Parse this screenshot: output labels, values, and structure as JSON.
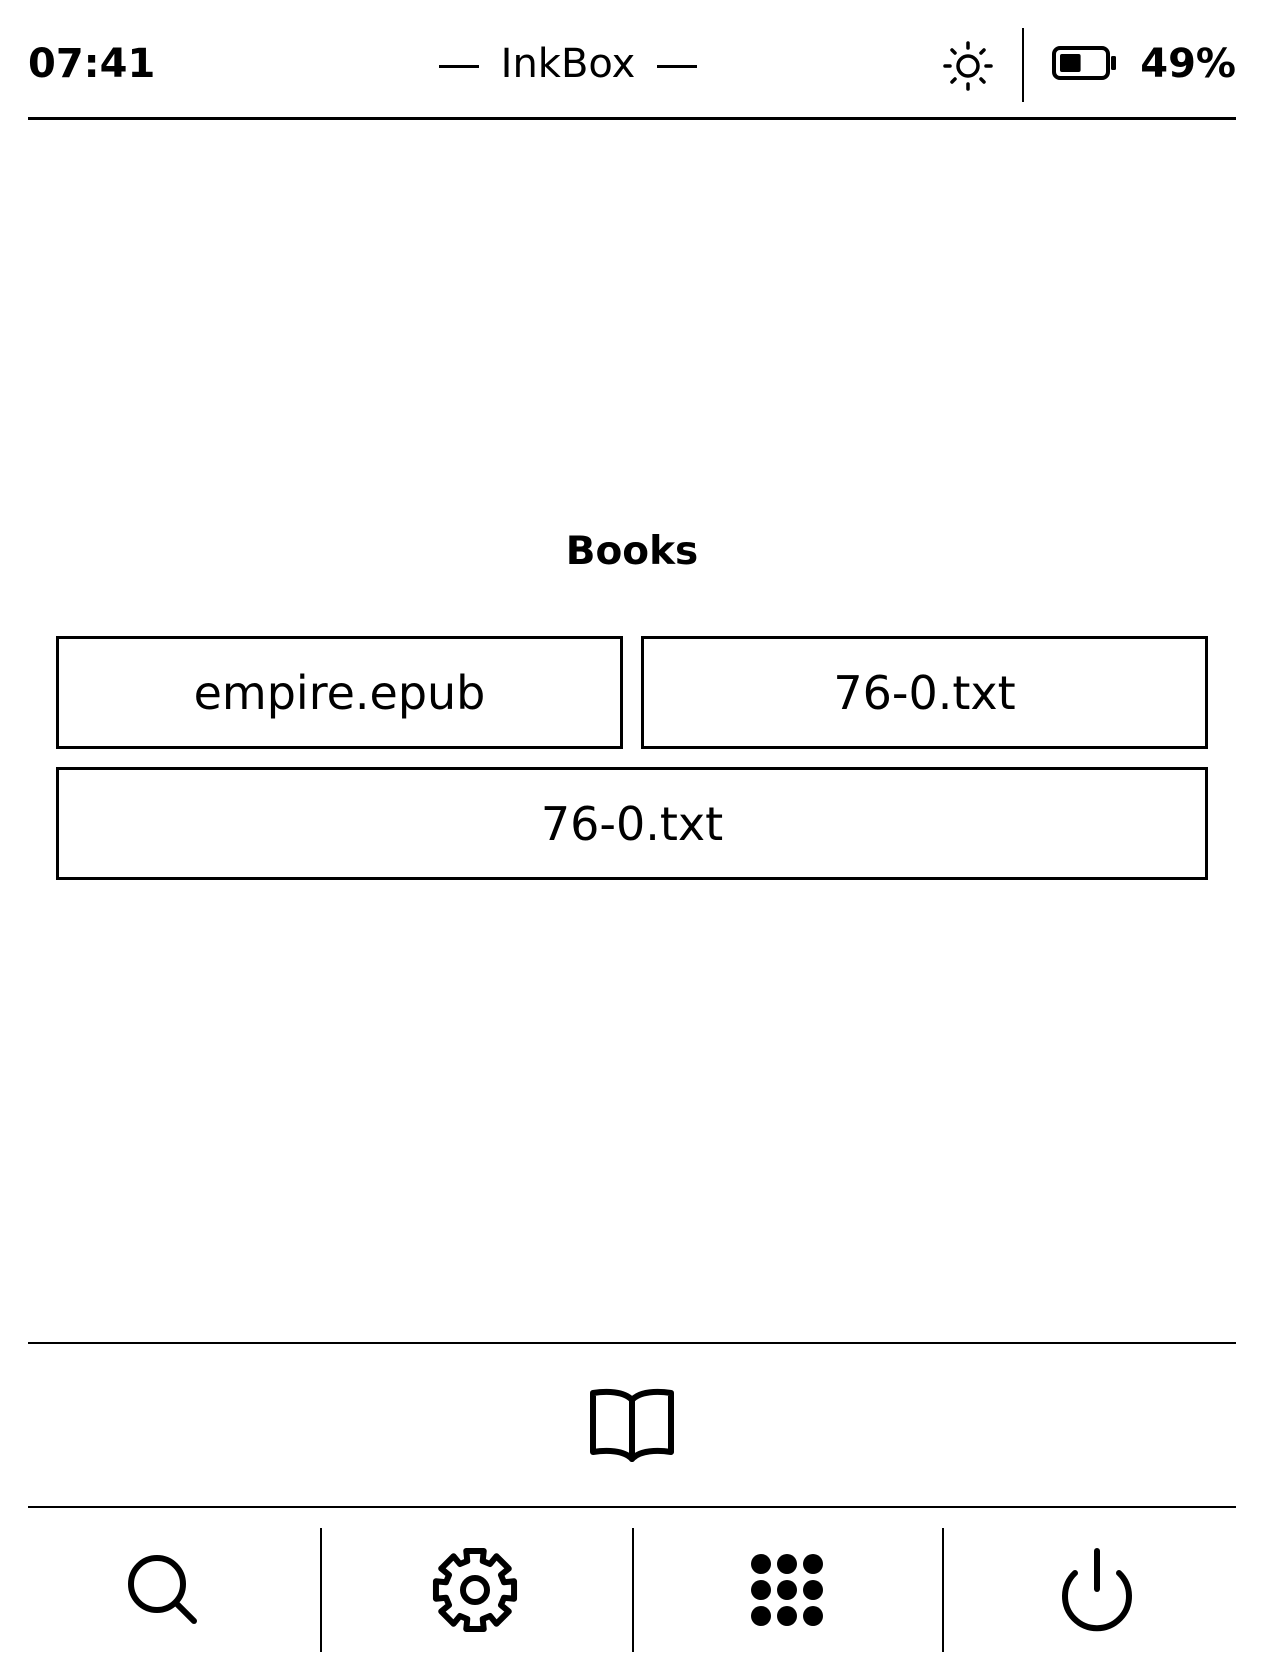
{
  "status_bar": {
    "time": "07:41",
    "title": "InkBox",
    "brightness_icon": "brightness-icon",
    "battery_icon": "battery-icon",
    "battery_level": 0.49,
    "battery_percent": "49%"
  },
  "main": {
    "heading": "Books",
    "books": [
      {
        "label": "empire.epub"
      },
      {
        "label": "76-0.txt"
      },
      {
        "label": "76-0.txt"
      }
    ]
  },
  "bottom_bar": {
    "library_icon": "book-open-icon",
    "nav": [
      {
        "icon": "search-icon"
      },
      {
        "icon": "gear-icon"
      },
      {
        "icon": "apps-grid-icon"
      },
      {
        "icon": "power-icon"
      }
    ]
  }
}
